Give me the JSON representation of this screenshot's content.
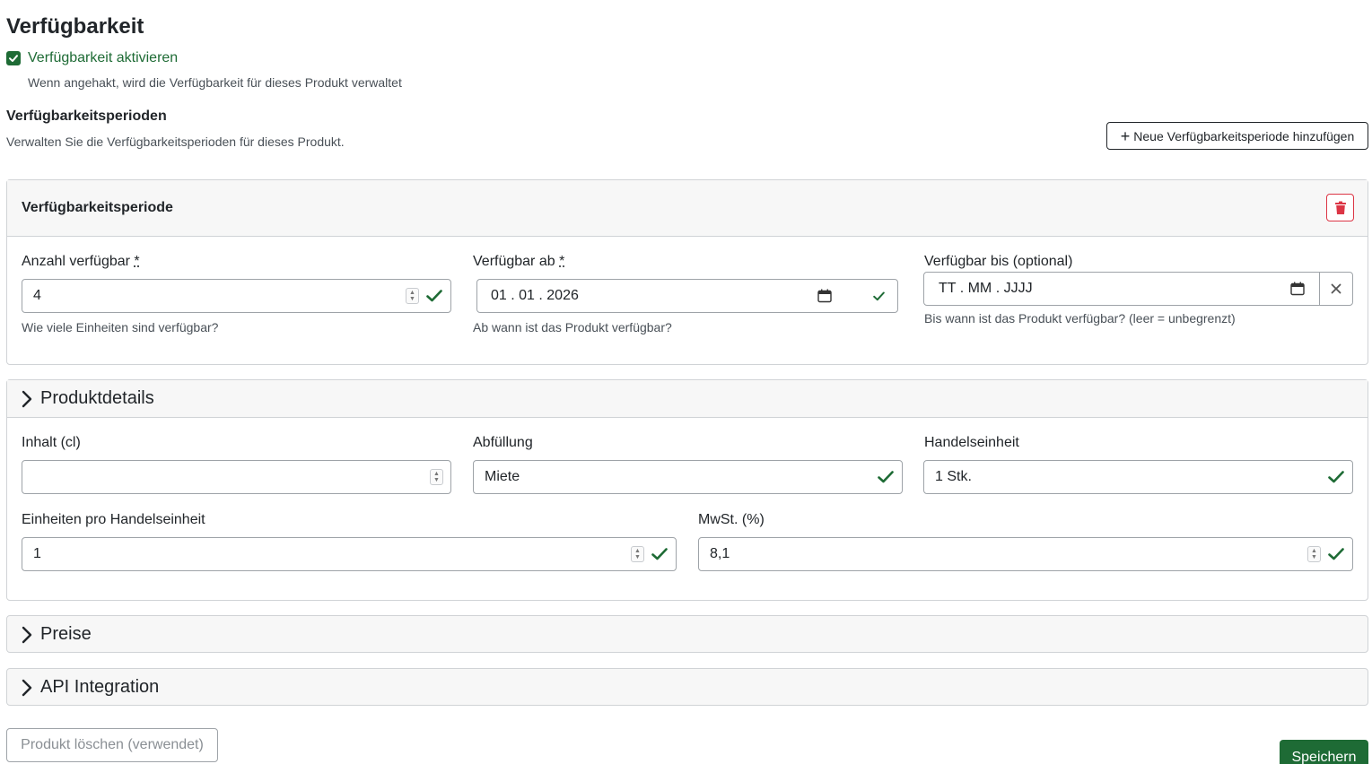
{
  "header": {
    "title": "Verfügbarkeit",
    "enable_label": "Verfügbarkeit aktivieren",
    "enable_checked": true,
    "enable_help": "Wenn angehakt, wird die Verfügbarkeit für dieses Produkt verwaltet"
  },
  "periods": {
    "title": "Verfügbarkeitsperioden",
    "subtitle": "Verwalten Sie die Verfügbarkeitsperioden für dieses Produkt.",
    "add_button": "Neue Verfügbarkeitsperiode hinzufügen",
    "card_title": "Verfügbarkeitsperiode",
    "quantity": {
      "label": "Anzahl verfügbar",
      "required_mark": "*",
      "value": "4",
      "help": "Wie viele Einheiten sind verfügbar?"
    },
    "from": {
      "label": "Verfügbar ab",
      "required_mark": "*",
      "value": "01 . 01 . 2026",
      "help": "Ab wann ist das Produkt verfügbar?"
    },
    "until": {
      "label": "Verfügbar bis (optional)",
      "placeholder": "TT . MM . JJJJ",
      "help": "Bis wann ist das Produkt verfügbar? (leer = unbegrenzt)"
    }
  },
  "details": {
    "title": "Produktdetails",
    "content": {
      "label": "Inhalt (cl)",
      "value": ""
    },
    "filling": {
      "label": "Abfüllung",
      "value": "Miete"
    },
    "trade_unit": {
      "label": "Handelseinheit",
      "value": "1 Stk."
    },
    "units_per_trade_unit": {
      "label": "Einheiten pro Handelseinheit",
      "value": "1"
    },
    "vat": {
      "label": "MwSt. (%)",
      "value": "8,1"
    }
  },
  "sections": {
    "prices": "Preise",
    "api": "API Integration"
  },
  "footer": {
    "delete_button": "Produkt löschen (verwendet)",
    "save_button": "Speichern"
  },
  "colors": {
    "accent": "#1e6b35",
    "danger": "#dc3545"
  }
}
